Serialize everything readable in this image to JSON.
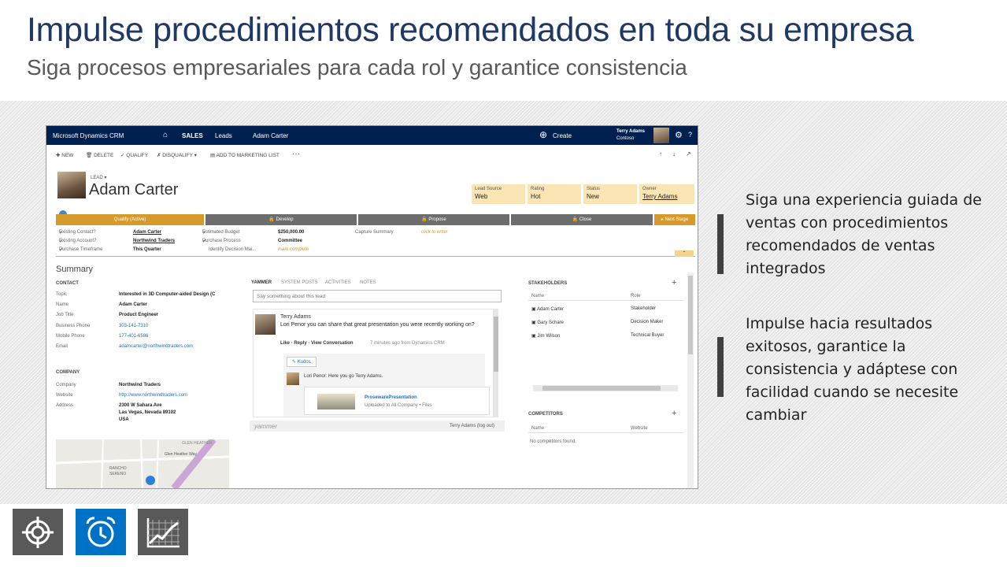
{
  "slide": {
    "title": "Impulse procedimientos recomendados en toda su empresa",
    "subtitle": "Siga procesos empresariales para cada rol y garantice consistencia"
  },
  "crm": {
    "nav": {
      "brand": "Microsoft Dynamics CRM",
      "home_icon": "home-icon",
      "sales": "SALES",
      "leads": "Leads",
      "record": "Adam Carter",
      "create": "Create",
      "user_name": "Terry Adams",
      "user_org": "Contoso"
    },
    "commands": [
      "NEW",
      "DELETE",
      "QUALIFY",
      "DISQUALIFY",
      "ADD TO MARKETING LIST"
    ],
    "header": {
      "entity": "LEAD",
      "name": "Adam Carter",
      "fields": [
        {
          "label": "Lead Source",
          "value": "Web"
        },
        {
          "label": "Rating",
          "value": "Hot"
        },
        {
          "label": "Status",
          "value": "New"
        },
        {
          "label": "Owner",
          "value": "Terry Adams"
        }
      ]
    },
    "stages": [
      "Qualify (Active)",
      "Develop",
      "Propose",
      "Close",
      "Next Stage"
    ],
    "steps": {
      "col1": [
        {
          "label": "Existing Contact?",
          "value": "Adam Carter"
        },
        {
          "label": "Existing Account?",
          "value": "Northwind Traders"
        },
        {
          "label": "Purchase Timeframe",
          "value": "This Quarter"
        }
      ],
      "col2": [
        {
          "label": "Estimated Budget",
          "value": "$250,000.00"
        },
        {
          "label": "Purchase Process",
          "value": "Committee"
        },
        {
          "label": "Identify Decision Mai...",
          "value": "mark complete"
        }
      ],
      "col3": [
        {
          "label": "Capture Summary",
          "value": "click to enter"
        }
      ]
    },
    "summary": {
      "heading": "Summary",
      "contact_heading": "CONTACT",
      "contact": [
        {
          "label": "Topic",
          "value": "Interested in 3D Computer-aided Design (C"
        },
        {
          "label": "Name",
          "value": "Adam Carter"
        },
        {
          "label": "Job Title",
          "value": "Product Engineer"
        },
        {
          "label": "Business Phone",
          "value": "303-141-7310"
        },
        {
          "label": "Mobile Phone",
          "value": "177-401-6586"
        },
        {
          "label": "Email",
          "value": "adamcarter@northwindtraders.com"
        }
      ],
      "company_heading": "COMPANY",
      "company": [
        {
          "label": "Company",
          "value": "Northwind Traders"
        },
        {
          "label": "Website",
          "value": "http://www.northwindtraders.com"
        },
        {
          "label": "Address",
          "value": "2300 W Sahara Ave"
        },
        {
          "label": "",
          "value": "Las Vegas, Nevada 89102"
        },
        {
          "label": "",
          "value": "USA"
        }
      ],
      "map_labels": [
        "RANCHO",
        "SERENO",
        "Glen Heather Way",
        "GLEN HEATHER"
      ]
    },
    "yammer": {
      "tabs": [
        "YAMMER",
        "SYSTEM POSTS",
        "ACTIVITIES",
        "NOTES"
      ],
      "placeholder": "Say something about this lead",
      "post_author": "Terry Adams",
      "post_text": "Lori Penor you can share that great presentation you were recently working on?",
      "post_actions": "Like · Reply · View Conversation",
      "post_meta": "7 minutes ago from Dynamics CRM",
      "kudos": "Kudos",
      "reply": "Lori Penor: Here you go Terry Adams.",
      "file_name": "ProsewarePresentation",
      "file_meta": "Uploaded to All Company • Files",
      "footer_brand": "yammer",
      "footer_user": "Terry Adams (log out)"
    },
    "stakeholders": {
      "heading": "STAKEHOLDERS",
      "col_name": "Name",
      "col_role": "Role",
      "rows": [
        {
          "name": "Adam Carter",
          "role": "Stakeholder"
        },
        {
          "name": "Gary Schare",
          "role": "Decision Maker"
        },
        {
          "name": "Jim Wilson",
          "role": "Technical Buyer"
        }
      ]
    },
    "competitors": {
      "heading": "COMPETITORS",
      "col_name": "Name",
      "col_site": "Website",
      "empty": "No competitors found."
    }
  },
  "bullets": [
    "Siga una experiencia guiada de ventas con procedimientos recomendados de ventas integrados",
    "Impulse hacia resultados exitosos, garantice la consistencia y adáptese con facilidad cuando se necesite cambiar"
  ],
  "icons": [
    {
      "name": "target-icon",
      "bg": "#595959"
    },
    {
      "name": "alarm-clock-icon",
      "bg": "#0072c6"
    },
    {
      "name": "growth-chart-icon",
      "bg": "#595959"
    }
  ]
}
